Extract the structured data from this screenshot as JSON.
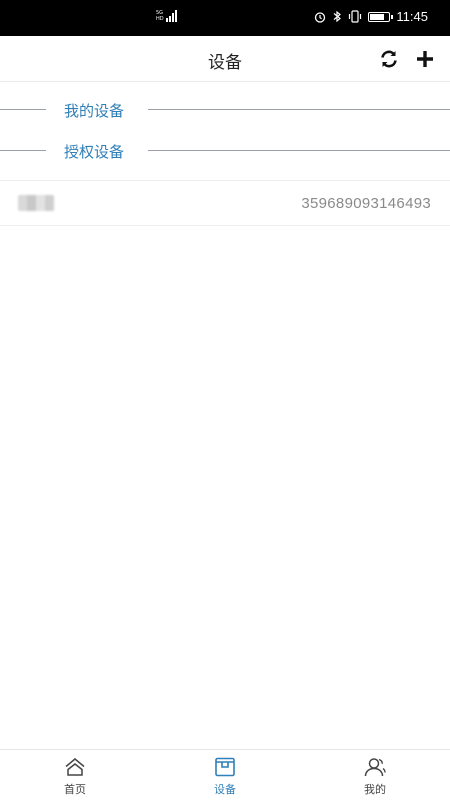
{
  "status_bar": {
    "network_label_top": "5G",
    "network_label_bottom": "HD",
    "time": "11:45",
    "icons": [
      "alarm-icon",
      "bluetooth-icon",
      "vibrate-icon",
      "battery-icon"
    ]
  },
  "header": {
    "title": "设备",
    "actions": [
      "refresh-icon",
      "plus-icon"
    ]
  },
  "sections": {
    "my_devices": "我的设备",
    "authorized_devices": "授权设备"
  },
  "device": {
    "name": "",
    "id": "359689093146493"
  },
  "bottom_nav": {
    "items": [
      {
        "label": "首页",
        "icon": "home-icon",
        "active": false
      },
      {
        "label": "设备",
        "icon": "device-icon",
        "active": true
      },
      {
        "label": "我的",
        "icon": "user-icon",
        "active": false
      }
    ]
  },
  "colors": {
    "accent": "#2f7fb8",
    "status_bar_bg": "#000000",
    "divider": "#9aa0a6",
    "device_id_text": "#8a8a8a"
  }
}
